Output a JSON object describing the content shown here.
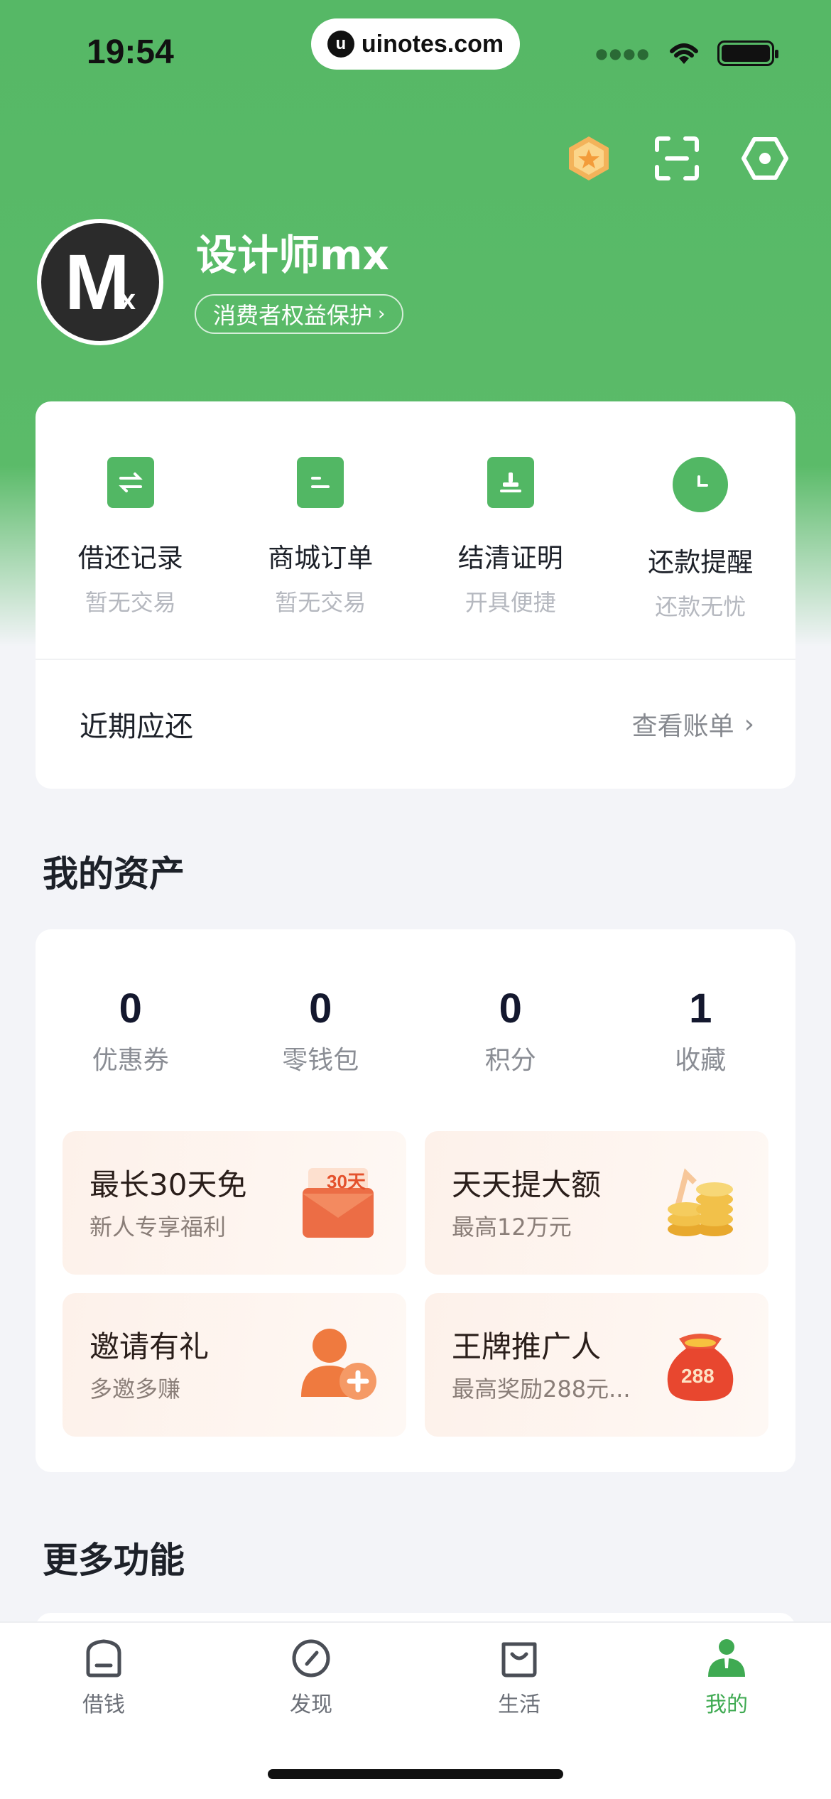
{
  "status": {
    "time": "19:54",
    "url": "uinotes.com"
  },
  "profile": {
    "name": "设计师mx",
    "badge": "消费者权益保护",
    "avatar_text": "M",
    "avatar_sub": "x"
  },
  "quick_actions": [
    {
      "title": "借还记录",
      "sub": "暂无交易",
      "icon": "swap-icon"
    },
    {
      "title": "商城订单",
      "sub": "暂无交易",
      "icon": "order-icon"
    },
    {
      "title": "结清证明",
      "sub": "开具便捷",
      "icon": "stamp-icon"
    },
    {
      "title": "还款提醒",
      "sub": "还款无忧",
      "icon": "clock-icon"
    }
  ],
  "recent": {
    "label": "近期应还",
    "link": "查看账单"
  },
  "assets": {
    "title": "我的资产",
    "stats": [
      {
        "value": "0",
        "label": "优惠券"
      },
      {
        "value": "0",
        "label": "零钱包"
      },
      {
        "value": "0",
        "label": "积分"
      },
      {
        "value": "1",
        "label": "收藏"
      }
    ],
    "promos": [
      {
        "title": "最长30天免",
        "sub": "新人专享福利",
        "art_text": "30天"
      },
      {
        "title": "天天提大额",
        "sub": "最高12万元",
        "art_text": ""
      },
      {
        "title": "邀请有礼",
        "sub": "多邀多赚",
        "art_text": ""
      },
      {
        "title": "王牌推广人",
        "sub": "最高奖励288元...",
        "art_text": "288"
      }
    ]
  },
  "more": {
    "title": "更多功能"
  },
  "tabs": [
    {
      "label": "借钱"
    },
    {
      "label": "发现"
    },
    {
      "label": "生活"
    },
    {
      "label": "我的"
    }
  ],
  "colors": {
    "brand_green": "#56b866",
    "active_tab": "#3faa52"
  }
}
